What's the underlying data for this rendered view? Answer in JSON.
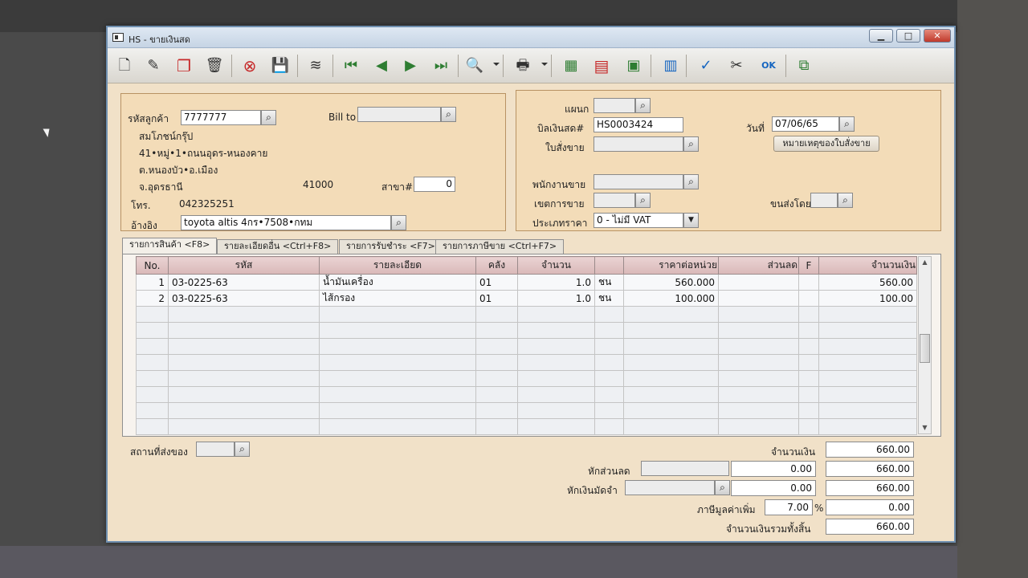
{
  "window": {
    "title": "HS - ขายเงินสด",
    "btn_min": "▁",
    "btn_max": "□",
    "btn_close": "✕"
  },
  "toolbar": [
    {
      "icon": "new-document-icon",
      "glyph": "🗋"
    },
    {
      "icon": "edit-document-icon",
      "glyph": "✎"
    },
    {
      "icon": "copy-document-icon",
      "glyph": "❐"
    },
    {
      "icon": "trash-icon",
      "glyph": "🗑"
    },
    {
      "icon": "cancel-icon",
      "glyph": "⊗"
    },
    {
      "icon": "save-icon",
      "glyph": "💾"
    },
    {
      "icon": "stack-icon",
      "glyph": "≋"
    },
    {
      "icon": "first-record-icon",
      "glyph": "⏮"
    },
    {
      "icon": "previous-record-icon",
      "glyph": "◀"
    },
    {
      "icon": "next-record-icon",
      "glyph": "▶"
    },
    {
      "icon": "last-record-icon",
      "glyph": "⏭"
    },
    {
      "icon": "find-icon",
      "glyph": "🔍"
    },
    {
      "icon": "printer-icon",
      "glyph": "🖶"
    },
    {
      "icon": "calculator-icon",
      "glyph": "▦"
    },
    {
      "icon": "form-icon",
      "glyph": "▤"
    },
    {
      "icon": "monitor-icon",
      "glyph": "▣"
    },
    {
      "icon": "report-icon",
      "glyph": "▥"
    },
    {
      "icon": "approve-icon",
      "glyph": "✓"
    },
    {
      "icon": "tools-icon",
      "glyph": "✂"
    },
    {
      "icon": "ok-icon",
      "glyph": "OK"
    },
    {
      "icon": "network-icon",
      "glyph": "⧉"
    }
  ],
  "customer": {
    "code_label": "รหัสลูกค้า",
    "code_value": "7777777",
    "bill_to_label": "Bill to",
    "bill_to_value": "",
    "name": "สมโภชน์กรุ๊ป",
    "address1": "41•หมู่•1•ถนนอุดร-หนองคาย",
    "address2": "ต.หนองบัว•อ.เมือง",
    "province": "จ.อุดรธานี",
    "zip": "41000",
    "branch_label": "สาขา#",
    "branch_value": "0",
    "phone_label": "โทร.",
    "phone_value": "042325251",
    "ref_label": "อ้างอิง",
    "ref_value": "toyota altis 4กร•7508•กทม"
  },
  "invoice": {
    "dept_label": "แผนก",
    "dept_value": "",
    "bill_no_label": "บิลเงินสด#",
    "bill_no_value": "HS0003424",
    "order_label": "ใบสั่งขาย",
    "order_value": "",
    "date_label": "วันที่",
    "date_value": "07/06/65",
    "remark_button": "หมายเหตุของใบสั่งขาย",
    "salesman_label": "พนักงานขาย",
    "salesman_value": "",
    "area_label": "เขตการขาย",
    "area_value": "",
    "ship_by_label": "ขนส่งโดย",
    "ship_by_value": "",
    "price_type_label": "ประเภทราคา",
    "price_type_value": "0 - ไม่มี VAT"
  },
  "tabs": [
    "รายการสินค้า <F8>",
    "รายละเอียดอื่น <Ctrl+F8>",
    "รายการรับชำระ <F7>",
    "รายการภาษีขาย <Ctrl+F7>"
  ],
  "grid": {
    "headers": [
      "No.",
      "รหัส",
      "รายละเอียด",
      "คลัง",
      "จำนวน",
      "",
      "ราคาต่อหน่วย",
      "ส่วนลด",
      "F",
      "จำนวนเงิน"
    ],
    "rows": [
      [
        "1",
        "03-0225-63",
        "น้ำมันเครื่อง",
        "01",
        "1.0",
        "ชน",
        "560.000",
        "",
        "",
        "560.00"
      ],
      [
        "2",
        "03-0225-63",
        "ไส้กรอง",
        "01",
        "1.0",
        "ชน",
        "100.000",
        "",
        "",
        "100.00"
      ]
    ],
    "scroll_up": "▲",
    "scroll_down": "▼"
  },
  "footer": {
    "delivery_label": "สถานที่ส่งของ",
    "delivery_value": "",
    "amount_label": "จำนวนเงิน",
    "amount_value": "660.00",
    "discount_label": "หักส่วนลด",
    "discount_value": "0.00",
    "after_discount_value": "660.00",
    "deposit_label": "หักเงินมัดจำ",
    "deposit_value": "0.00",
    "after_deposit_value": "660.00",
    "vat_label": "ภาษีมูลค่าเพิ่ม",
    "vat_rate": "7.00",
    "vat_percent": "%",
    "vat_value": "0.00",
    "total_label": "จำนวนเงินรวมทั้งสิ้น",
    "total_value": "660.00"
  }
}
